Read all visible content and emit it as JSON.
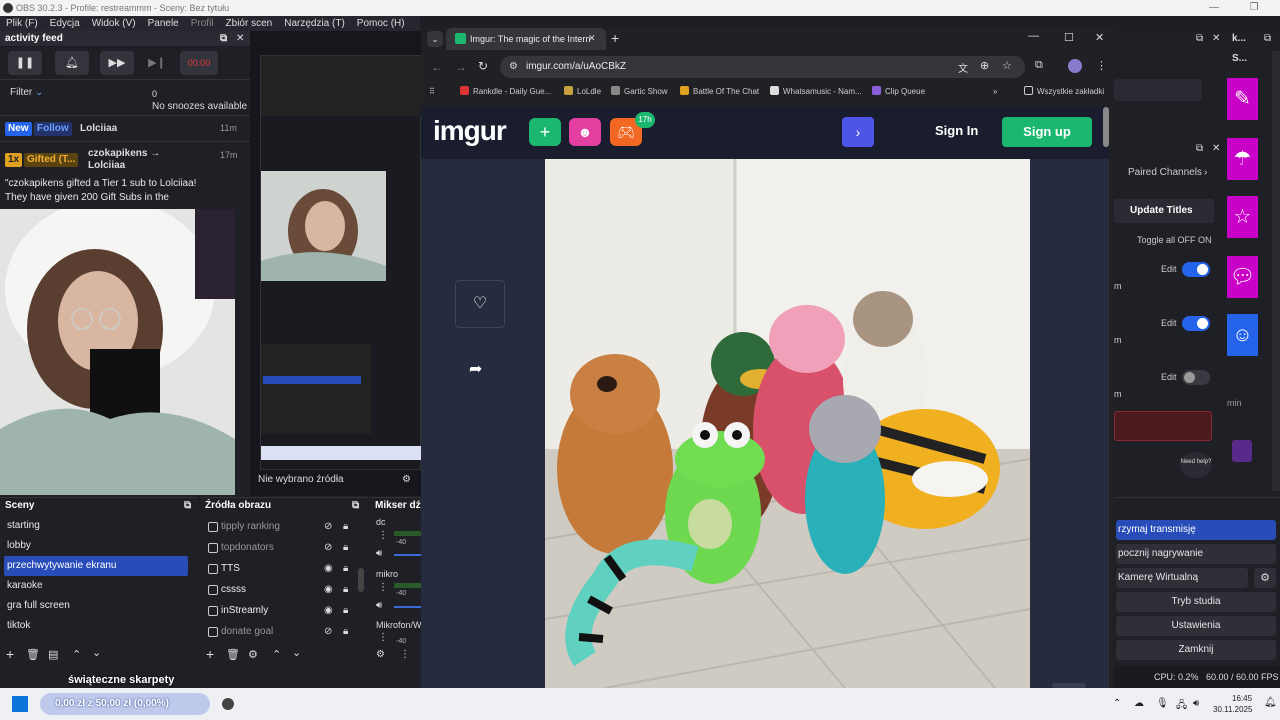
{
  "obs": {
    "title": "OBS 30.2.3 - Profile: restreammm - Sceny: Bez tytułu",
    "menu": [
      "Plik (F)",
      "Edycja",
      "Widok (V)",
      "Panele",
      "Profil",
      "Zbiór scen",
      "Narzędzia (T)",
      "Pomoc (H)"
    ],
    "activity_feed": {
      "title": "activity feed",
      "filter_label": "Filter",
      "snooze_count": "0",
      "snooze_text": "No snoozes available",
      "timer": "00:00",
      "events": [
        {
          "badge1": "New",
          "badge2": "Follow",
          "user": "Lolciiaa",
          "time": "11m"
        },
        {
          "badge1": "1x",
          "badge2": "Gifted (T...",
          "user": "czokapikens → Lolciiaa",
          "time": "17m",
          "message": "\"czokapikens gifted a Tier 1 sub to Lolciiaa! They have given 200 Gift Subs in the"
        }
      ]
    },
    "no_source": "Nie wybrano źródła",
    "scenes": {
      "title": "Sceny",
      "items": [
        "starting",
        "lobby",
        "przechwytywanie ekranu",
        "karaoke",
        "gra full screen",
        "tiktok"
      ],
      "selected_index": 2
    },
    "sources": {
      "title": "Źródła obrazu",
      "items": [
        {
          "name": "tipply ranking",
          "visible": false
        },
        {
          "name": "topdonators",
          "visible": false
        },
        {
          "name": "TTS",
          "visible": true
        },
        {
          "name": "cssss",
          "visible": true
        },
        {
          "name": "inStreamly",
          "visible": true
        },
        {
          "name": "donate goal",
          "visible": false
        }
      ]
    },
    "mixer": {
      "title": "Mikser dźw",
      "channels": [
        {
          "name": "dc",
          "level": "-40"
        },
        {
          "name": "mikro",
          "level": "-40"
        },
        {
          "name": "Mikrofon/W",
          "level": "-40"
        }
      ]
    },
    "controls": [
      "rzymaj transmisję",
      "pocznij nagrywanie",
      "Kamerę Wirtualną",
      "Tryb studia",
      "Ustawienia",
      "Zamknij"
    ],
    "status": {
      "cpu": "CPU: 0.2%",
      "fps": "60.00 / 60.00 FPS"
    },
    "right_panel": {
      "paired_channels": "Paired Channels",
      "update_titles": "Update Titles",
      "toggle_all": "Toggle all OFF",
      "toggle_on": "ON",
      "edit": "Edit",
      "need_help": "Need help?",
      "side_letters": [
        "m",
        "m",
        "m",
        "min"
      ],
      "top_label_k": "k...",
      "top_label_s": "S..."
    },
    "overlay_text": "świąteczne skarpety",
    "goal_text": "0,00 zł z 50,00 zł (0,00%)"
  },
  "browser": {
    "tab_title": "Imgur: The magic of the Intern",
    "url": "imgur.com/a/uAoCBkZ",
    "bookmarks": [
      "Rankdle - Daily Gue...",
      "LoLdle",
      "Gartic Show",
      "Battle Of The Chat",
      "Whatsamusic - Nam...",
      "Clip Queue"
    ],
    "bookmarks_all": "Wszystkie zakładki",
    "imgur": {
      "logo": "imgur",
      "badge": "17h",
      "sign_in": "Sign In",
      "sign_up": "Sign up"
    }
  },
  "taskbar": {
    "time": "16:45",
    "date": "30.11.2025"
  },
  "colors": {
    "obs_blue": "#284cb8",
    "imgur_green": "#1bb76e",
    "purple": "#c800c8"
  }
}
